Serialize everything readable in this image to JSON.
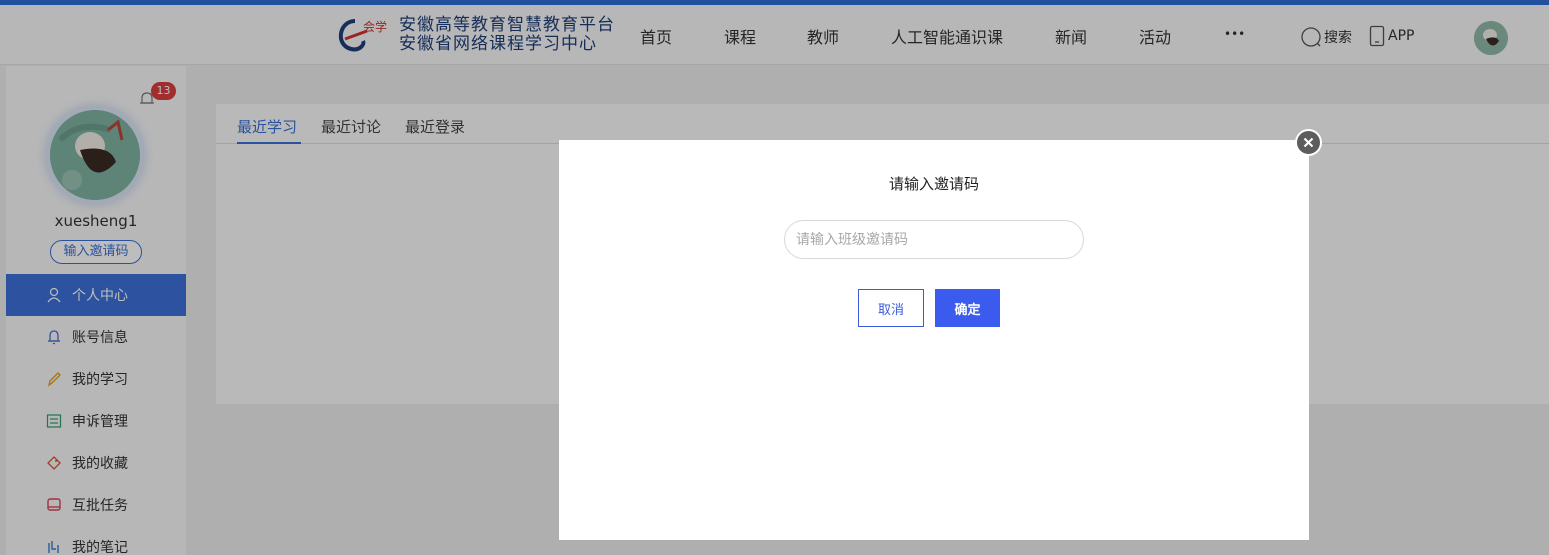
{
  "header": {
    "logo": {
      "brand_mark": "e会学",
      "line1": "安徽高等教育智慧教育平台",
      "line2": "安徽省网络课程学习中心"
    },
    "nav": [
      "首页",
      "课程",
      "教师",
      "人工智能通识课",
      "新闻",
      "活动",
      "•••"
    ],
    "search_label": "搜索",
    "app_label": "APP"
  },
  "sidebar": {
    "notification_count": "13",
    "username": "xuesheng1",
    "invite_button": "输入邀请码",
    "menu": [
      {
        "label": "个人中心",
        "icon": "user-icon",
        "active": true
      },
      {
        "label": "账号信息",
        "icon": "bell-icon",
        "active": false
      },
      {
        "label": "我的学习",
        "icon": "pencil-icon",
        "active": false
      },
      {
        "label": "申诉管理",
        "icon": "list-icon",
        "active": false
      },
      {
        "label": "我的收藏",
        "icon": "tag-icon",
        "active": false
      },
      {
        "label": "互批任务",
        "icon": "box-icon",
        "active": false
      },
      {
        "label": "我的笔记",
        "icon": "note-icon",
        "active": false
      }
    ]
  },
  "main": {
    "tabs": [
      {
        "label": "最近学习",
        "active": true
      },
      {
        "label": "最近讨论",
        "active": false
      },
      {
        "label": "最近登录",
        "active": false
      }
    ]
  },
  "modal": {
    "title": "请输入邀请码",
    "input_placeholder": "请输入班级邀请码",
    "input_value": "",
    "cancel_label": "取消",
    "confirm_label": "确定"
  },
  "colors": {
    "accent": "#3b6fd4",
    "active_menu": "#3c6fd8",
    "badge": "#d93f3f",
    "confirm": "#3b5bee"
  }
}
